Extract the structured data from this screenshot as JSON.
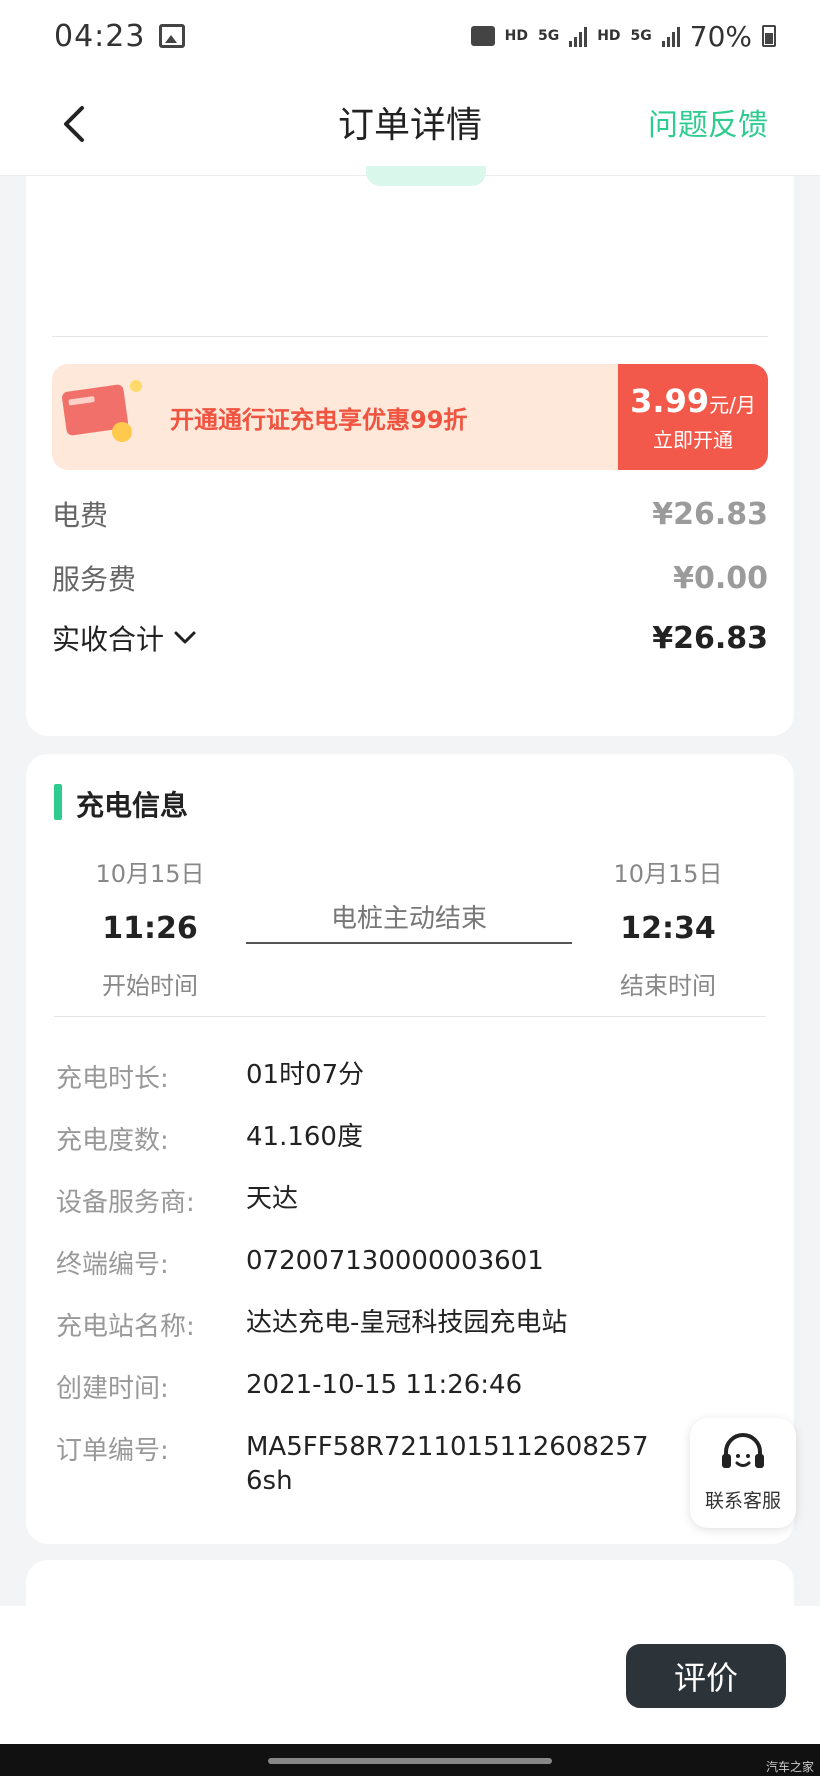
{
  "status_bar": {
    "time": "04:23",
    "hd1": "HD",
    "net1": "5G",
    "hd2": "HD",
    "net2": "5G",
    "battery_pct": "70%"
  },
  "header": {
    "title": "订单详情",
    "feedback": "问题反馈"
  },
  "promo": {
    "text": "开通通行证充电享优惠99折",
    "price": "3.99",
    "unit": "元/月",
    "cta": "立即开通"
  },
  "fees": {
    "electricity_label": "电费",
    "electricity_value": "¥26.83",
    "service_label": "服务费",
    "service_value": "¥0.00",
    "total_label": "实收合计",
    "total_value": "¥26.83"
  },
  "charging": {
    "section_title": "充电信息",
    "start_date": "10月15日",
    "start_time": "11:26",
    "start_label": "开始时间",
    "end_date": "10月15日",
    "end_time": "12:34",
    "end_label": "结束时间",
    "end_reason": "电桩主动结束",
    "details": [
      {
        "label": "充电时长:",
        "value": "01时07分"
      },
      {
        "label": "充电度数:",
        "value": "41.160度"
      },
      {
        "label": "设备服务商:",
        "value": "天达"
      },
      {
        "label": "终端编号:",
        "value": "072007130000003601"
      },
      {
        "label": "充电站名称:",
        "value": "达达充电-皇冠科技园充电站"
      },
      {
        "label": "创建时间:",
        "value": "2021-10-15 11:26:46"
      },
      {
        "label": "订单编号:",
        "value": "MA5FF58R72110151126082576sh"
      }
    ]
  },
  "customer_service": {
    "label": "联系客服"
  },
  "bottom": {
    "evaluate": "评价"
  },
  "watermark": "汽车之家",
  "colors": {
    "accent_green": "#2ecc8f",
    "promo_red": "#f2594a",
    "dark_button": "#2c3339"
  }
}
